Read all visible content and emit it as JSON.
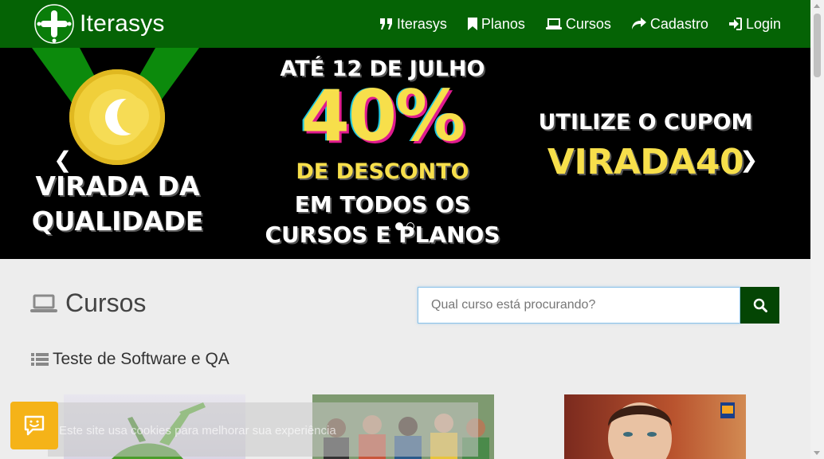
{
  "brand": {
    "name": "Iterasys",
    "logo_icon": "cross-logo-icon"
  },
  "nav": [
    {
      "label": "Iterasys",
      "icon": "quote-icon"
    },
    {
      "label": "Planos",
      "icon": "bookmark-icon"
    },
    {
      "label": "Cursos",
      "icon": "laptop-icon"
    },
    {
      "label": "Cadastro",
      "icon": "share-arrow-icon"
    },
    {
      "label": "Login",
      "icon": "sign-in-icon"
    }
  ],
  "banner": {
    "left_line1": "VIRADA DA",
    "left_line2": "QUALIDADE",
    "date": "ATÉ 12 DE JULHO",
    "percent": "40%",
    "discount": "DE DESCONTO",
    "line_a": "EM TODOS OS",
    "line_b": "CURSOS E PLANOS",
    "utilize": "UTILIZE O CUPOM",
    "coupon": "VIRADA40",
    "prev_glyph": "❮",
    "next_glyph": "❯",
    "slides": 2,
    "active_slide": 0
  },
  "courses": {
    "title": "Cursos",
    "search_placeholder": "Qual curso está procurando?",
    "category": "Teste de Software e QA"
  },
  "cookie": {
    "text": "Este site usa cookies para melhorar sua experiência"
  },
  "colors": {
    "primary": "#056305",
    "accent": "#f7df4b",
    "chat": "#f5b318"
  }
}
